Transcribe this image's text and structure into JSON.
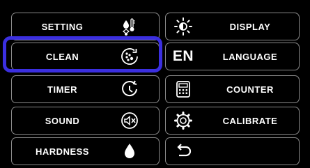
{
  "menu": {
    "left": [
      {
        "label": "SETTING",
        "icon": "bulb-thermometer-icon"
      },
      {
        "label": "CLEAN",
        "icon": "clean-dots-icon",
        "selected": true
      },
      {
        "label": "TIMER",
        "icon": "timer-icon"
      },
      {
        "label": "SOUND",
        "icon": "sound-mute-icon"
      },
      {
        "label": "HARDNESS",
        "icon": "water-drop-icon"
      }
    ],
    "right": [
      {
        "label": "DISPLAY",
        "icon": "brightness-icon"
      },
      {
        "label": "LANGUAGE",
        "icon": "language-icon",
        "icon_text": "EN"
      },
      {
        "label": "COUNTER",
        "icon": "counter-icon"
      },
      {
        "label": "CALIBRATE",
        "icon": "gear-icon"
      },
      {
        "label": "",
        "icon": "back-arrow-icon"
      }
    ]
  },
  "colors": {
    "background": "#000000",
    "border": "#8a8a8a",
    "selection": "#3b2fe0",
    "text": "#ffffff"
  }
}
